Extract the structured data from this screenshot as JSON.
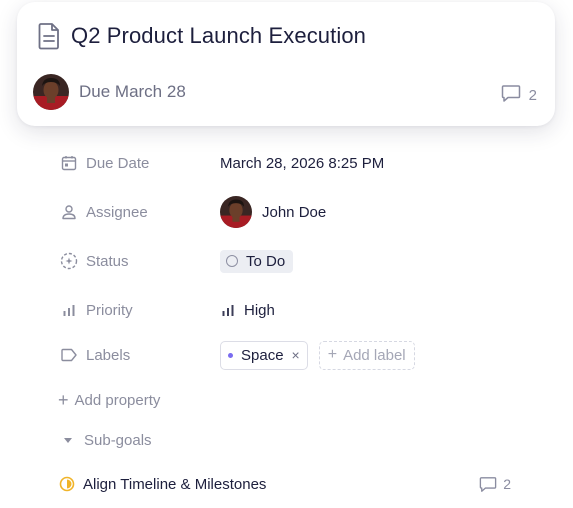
{
  "card": {
    "title": "Q2 Product Launch Execution",
    "due_text": "Due March 28",
    "comment_count": "2",
    "title_icon": "document-icon"
  },
  "properties": {
    "due_date": {
      "label": "Due Date",
      "value": "March 28, 2026 8:25 PM",
      "icon": "calendar-icon"
    },
    "assignee": {
      "label": "Assignee",
      "value": "John Doe",
      "icon": "person-icon"
    },
    "status": {
      "label": "Status",
      "value": "To Do",
      "icon": "status-dashed-circle-icon"
    },
    "priority": {
      "label": "Priority",
      "value": "High",
      "icon": "priority-bars-icon"
    },
    "labels": {
      "label": "Labels",
      "chips": [
        {
          "text": "Space",
          "color": "#7a6cf0"
        }
      ],
      "add_label": "Add label",
      "icon": "tag-icon"
    }
  },
  "add_property": "Add property",
  "subgoals": {
    "header": "Sub-goals",
    "items": [
      {
        "title": "Align Timeline & Milestones",
        "comment_count": "2",
        "status_color": "#f0b429"
      }
    ]
  },
  "colors": {
    "accent": "#7a6cf0",
    "text": "#1d1f3d",
    "muted": "#8b8d9e",
    "in_progress": "#f0b429"
  }
}
